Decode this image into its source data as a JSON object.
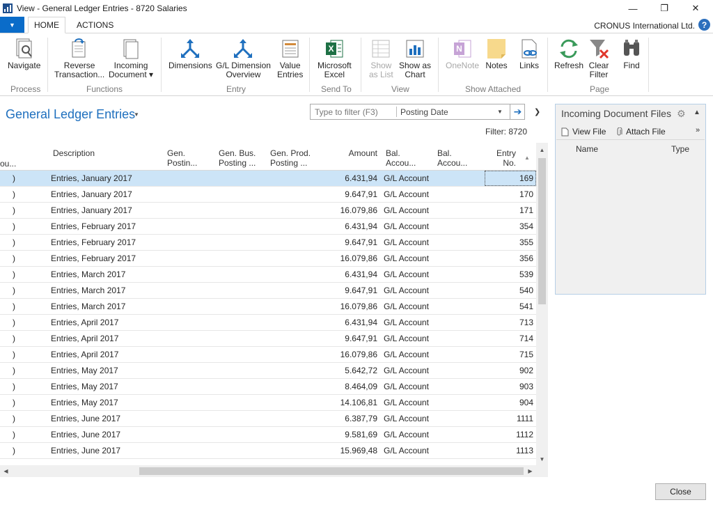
{
  "window": {
    "title": "View - General Ledger Entries - 8720 Salaries",
    "minimize": "—",
    "restore": "❐",
    "close": "✕"
  },
  "ribbon_tabs": {
    "app_menu": "▼",
    "home": "HOME",
    "actions": "ACTIONS",
    "company": "CRONUS International Ltd.",
    "help": "?"
  },
  "ribbon": {
    "navigate": "Navigate",
    "reverse_1": "Reverse",
    "reverse_2": "Transaction...",
    "incoming_1": "Incoming",
    "incoming_2": "Document ▾",
    "dimensions": "Dimensions",
    "gl_dim_1": "G/L Dimension",
    "gl_dim_2": "Overview",
    "value_1": "Value",
    "value_2": "Entries",
    "excel_1": "Microsoft",
    "excel_2": "Excel",
    "show_list_1": "Show",
    "show_list_2": "as List",
    "show_chart_1": "Show as",
    "show_chart_2": "Chart",
    "onenote": "OneNote",
    "notes": "Notes",
    "links": "Links",
    "refresh": "Refresh",
    "clear_1": "Clear",
    "clear_2": "Filter",
    "find": "Find",
    "groups": {
      "process": "Process",
      "functions": "Functions",
      "entry": "Entry",
      "send_to": "Send To",
      "view": "View",
      "show_attached": "Show Attached",
      "page": "Page"
    },
    "colors": {
      "accent": "#1e6fbe",
      "excel": "#1e7145",
      "notes": "#f7d98c",
      "onenote": "#c6a3d6"
    }
  },
  "page": {
    "title": "General Ledger Entries",
    "filter_placeholder": "Type to filter (F3)",
    "filter_field": "Posting Date",
    "filter_text": "Filter: 8720"
  },
  "grid": {
    "headers": {
      "col0": "ou...",
      "description": "Description",
      "gen_posting": "Gen.\nPostin...",
      "gen_bus": "Gen. Bus.\nPosting ...",
      "gen_prod": "Gen. Prod.\nPosting ...",
      "amount": "Amount",
      "bal_account_type": "Bal.\nAccou...",
      "bal_account_no": "Bal.\nAccou...",
      "entry_no": "Entry\nNo."
    },
    "rows": [
      {
        "col0": ")",
        "description": "Entries, January 2017",
        "amount": "6.431,94",
        "bal_type": "G/L Account",
        "entry_no": "169"
      },
      {
        "col0": ")",
        "description": "Entries, January 2017",
        "amount": "9.647,91",
        "bal_type": "G/L Account",
        "entry_no": "170"
      },
      {
        "col0": ")",
        "description": "Entries, January 2017",
        "amount": "16.079,86",
        "bal_type": "G/L Account",
        "entry_no": "171"
      },
      {
        "col0": ")",
        "description": "Entries, February 2017",
        "amount": "6.431,94",
        "bal_type": "G/L Account",
        "entry_no": "354"
      },
      {
        "col0": ")",
        "description": "Entries, February 2017",
        "amount": "9.647,91",
        "bal_type": "G/L Account",
        "entry_no": "355"
      },
      {
        "col0": ")",
        "description": "Entries, February 2017",
        "amount": "16.079,86",
        "bal_type": "G/L Account",
        "entry_no": "356"
      },
      {
        "col0": ")",
        "description": "Entries, March 2017",
        "amount": "6.431,94",
        "bal_type": "G/L Account",
        "entry_no": "539"
      },
      {
        "col0": ")",
        "description": "Entries, March 2017",
        "amount": "9.647,91",
        "bal_type": "G/L Account",
        "entry_no": "540"
      },
      {
        "col0": ")",
        "description": "Entries, March 2017",
        "amount": "16.079,86",
        "bal_type": "G/L Account",
        "entry_no": "541"
      },
      {
        "col0": ")",
        "description": "Entries, April 2017",
        "amount": "6.431,94",
        "bal_type": "G/L Account",
        "entry_no": "713"
      },
      {
        "col0": ")",
        "description": "Entries, April 2017",
        "amount": "9.647,91",
        "bal_type": "G/L Account",
        "entry_no": "714"
      },
      {
        "col0": ")",
        "description": "Entries, April 2017",
        "amount": "16.079,86",
        "bal_type": "G/L Account",
        "entry_no": "715"
      },
      {
        "col0": ")",
        "description": "Entries, May 2017",
        "amount": "5.642,72",
        "bal_type": "G/L Account",
        "entry_no": "902"
      },
      {
        "col0": ")",
        "description": "Entries, May 2017",
        "amount": "8.464,09",
        "bal_type": "G/L Account",
        "entry_no": "903"
      },
      {
        "col0": ")",
        "description": "Entries, May 2017",
        "amount": "14.106,81",
        "bal_type": "G/L Account",
        "entry_no": "904"
      },
      {
        "col0": ")",
        "description": "Entries, June 2017",
        "amount": "6.387,79",
        "bal_type": "G/L Account",
        "entry_no": "1111"
      },
      {
        "col0": ")",
        "description": "Entries, June 2017",
        "amount": "9.581,69",
        "bal_type": "G/L Account",
        "entry_no": "1112"
      },
      {
        "col0": ")",
        "description": "Entries, June 2017",
        "amount": "15.969,48",
        "bal_type": "G/L Account",
        "entry_no": "1113"
      }
    ]
  },
  "factbox": {
    "title": "Incoming Document Files",
    "view_file": "View File",
    "attach_file": "Attach File",
    "col_name": "Name",
    "col_type": "Type"
  },
  "footer": {
    "close": "Close"
  }
}
